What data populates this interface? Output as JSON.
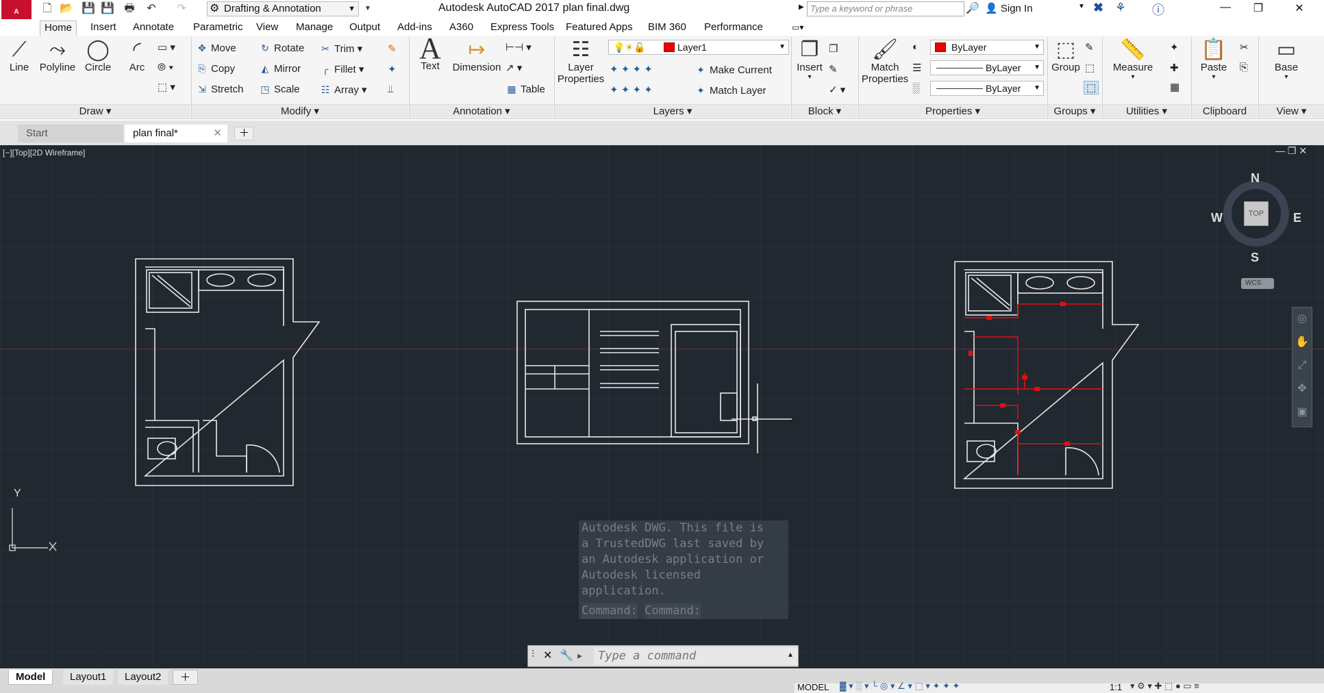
{
  "title": {
    "app_logo": "A",
    "window_title": "Autodesk AutoCAD 2017    plan final.dwg",
    "workspace": "Drafting & Annotation",
    "search_placeholder": "Type a keyword or phrase",
    "sign_in": "Sign In"
  },
  "ribbon_tabs": [
    "Home",
    "Insert",
    "Annotate",
    "Parametric",
    "View",
    "Manage",
    "Output",
    "Add-ins",
    "A360",
    "Express Tools",
    "Featured Apps",
    "BIM 360",
    "Performance"
  ],
  "draw": {
    "title": "Draw",
    "line": "Line",
    "polyline": "Polyline",
    "circle": "Circle",
    "arc": "Arc"
  },
  "modify": {
    "title": "Modify",
    "move": "Move",
    "rotate": "Rotate",
    "trim": "Trim",
    "copy": "Copy",
    "mirror": "Mirror",
    "fillet": "Fillet",
    "stretch": "Stretch",
    "scale": "Scale",
    "array": "Array"
  },
  "annotation": {
    "title": "Annotation",
    "text": "Text",
    "dimension": "Dimension",
    "table": "Table"
  },
  "layers": {
    "title": "Layers",
    "layer_properties_1": "Layer",
    "layer_properties_2": "Properties",
    "current_layer": "Layer1",
    "make_current": "Make Current",
    "match_layer": "Match Layer"
  },
  "block": {
    "title": "Block",
    "insert": "Insert"
  },
  "properties": {
    "title": "Properties",
    "match_1": "Match",
    "match_2": "Properties",
    "color": "ByLayer",
    "linetype": "ByLayer",
    "lineweight": "ByLayer"
  },
  "groups": {
    "title": "Groups",
    "group": "Group"
  },
  "utilities": {
    "title": "Utilities",
    "measure": "Measure"
  },
  "clipboard": {
    "title": "Clipboard",
    "paste": "Paste"
  },
  "view_panel": {
    "title": "View",
    "base": "Base"
  },
  "doc_tabs": {
    "start": "Start",
    "current": "plan final*"
  },
  "viewport": {
    "label": "[−][Top][2D Wireframe]",
    "viewcube_top": "TOP",
    "north": "N",
    "south": "S",
    "east": "E",
    "west": "W",
    "wcs": "WCS",
    "ucs_y": "Y"
  },
  "command": {
    "history": [
      "Autodesk DWG.  This file is",
      "a TrustedDWG last saved by",
      "an Autodesk application or",
      "Autodesk licensed",
      "application.",
      "Command:",
      "Command:"
    ],
    "placeholder": "Type a command"
  },
  "layout_tabs": [
    "Model",
    "Layout1",
    "Layout2"
  ],
  "status": {
    "model": "MODEL",
    "scale": "1:1"
  },
  "colors": {
    "canvas": "#212830",
    "accent": "#c8102e",
    "layer_color": "#e00000"
  }
}
